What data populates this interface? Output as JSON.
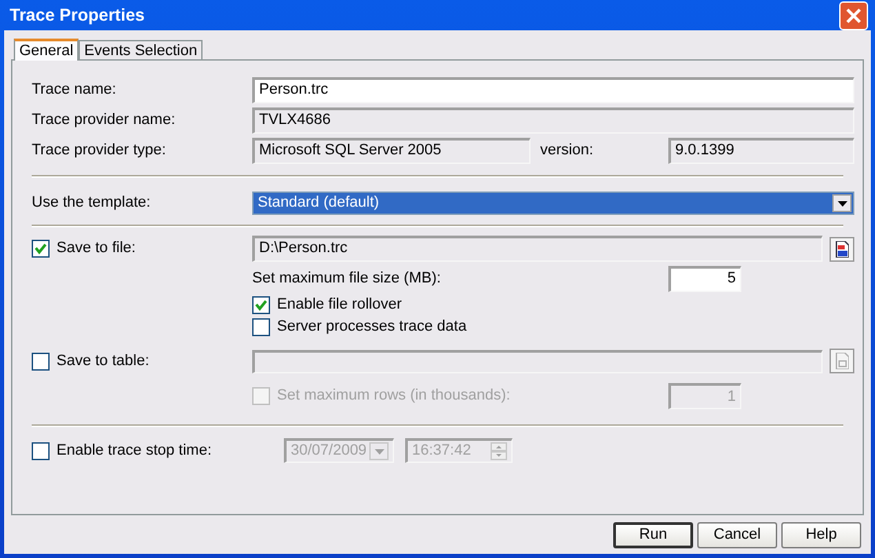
{
  "window": {
    "title": "Trace Properties"
  },
  "tabs": [
    {
      "label": "General",
      "selected": true
    },
    {
      "label": "Events Selection",
      "selected": false
    }
  ],
  "trace_name": {
    "label": "Trace name:",
    "value": "Person.trc",
    "readonly": false
  },
  "provider_name": {
    "label": "Trace provider name:",
    "value": "TVLX4686",
    "readonly": true
  },
  "provider_type": {
    "label": "Trace provider type:",
    "value": "Microsoft SQL Server 2005",
    "readonly": true,
    "version_label": "version:",
    "version": "9.0.1399"
  },
  "template": {
    "label": "Use the template:",
    "value": "Standard (default)"
  },
  "save_to_file": {
    "label": "Save to file:",
    "checked": true,
    "path": "D:\\Person.trc",
    "max_size_label": "Set maximum file size (MB):",
    "max_size": "5",
    "options": [
      {
        "label": "Enable file rollover",
        "checked": true
      },
      {
        "label": "Server processes trace data",
        "checked": false
      }
    ]
  },
  "save_to_table": {
    "label": "Save to table:",
    "checked": false,
    "disabled_fields": true,
    "max_rows": {
      "label": "Set maximum rows (in thousands):",
      "checked": false,
      "disabled": true,
      "value": "1"
    }
  },
  "stop_time": {
    "label": "Enable trace stop time:",
    "checked": false,
    "disabled_fields": true,
    "date": "30/07/2009",
    "time": "16:37:42"
  },
  "buttons": [
    {
      "label": "Run",
      "default": true
    },
    {
      "label": "Cancel",
      "default": false
    },
    {
      "label": "Help",
      "default": false
    }
  ]
}
